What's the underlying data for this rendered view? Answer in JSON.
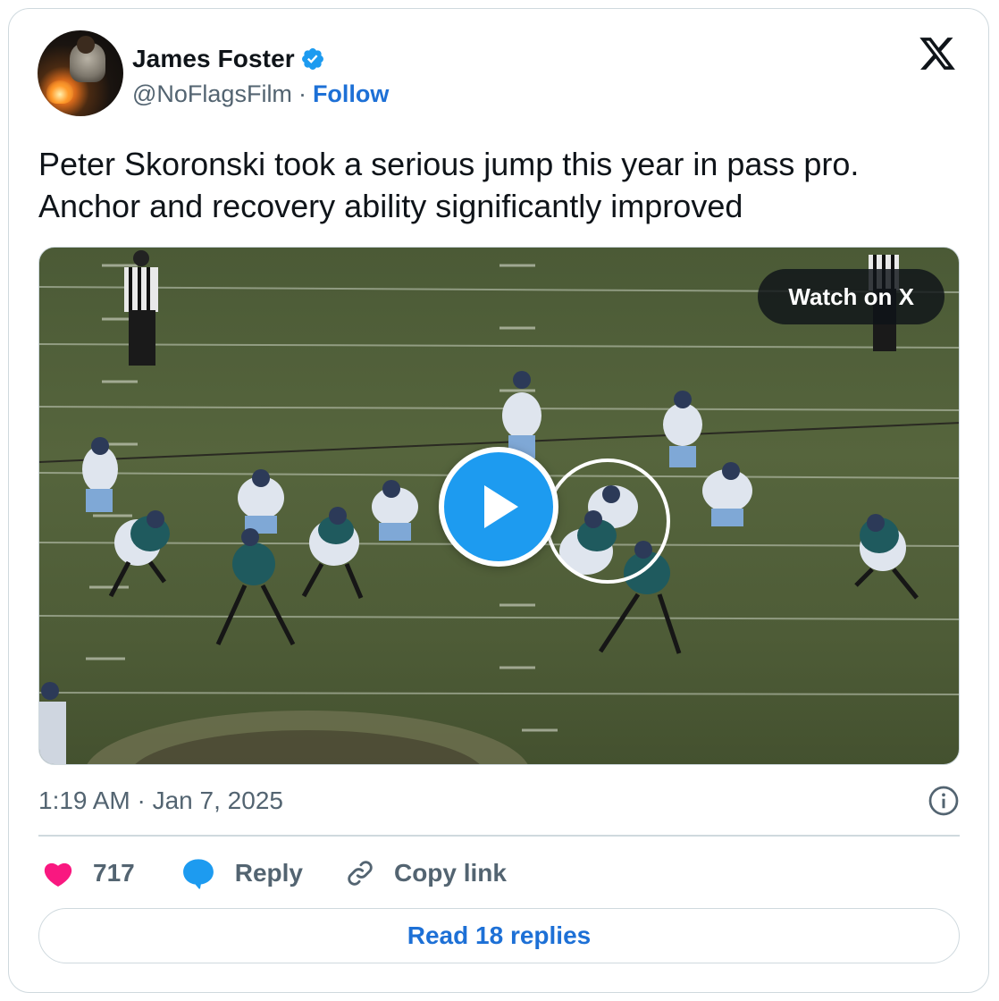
{
  "author": {
    "name": "James Foster",
    "handle": "@NoFlagsFilm",
    "separator": "·",
    "follow_label": "Follow"
  },
  "brand_icon": "x-logo-icon",
  "tweet": {
    "text": "Peter Skoronski took a serious jump this year in pass pro. Anchor and recovery ability significantly improved"
  },
  "media": {
    "watch_label": "Watch on X",
    "play_icon": "play-icon"
  },
  "meta": {
    "timestamp": "1:19 AM · Jan 7, 2025",
    "info_icon": "info-icon"
  },
  "actions": {
    "likes": "717",
    "reply_label": "Reply",
    "copy_label": "Copy link"
  },
  "footer": {
    "read_replies_label": "Read 18 replies"
  },
  "colors": {
    "link_blue": "#1d70d6",
    "verified_blue": "#1d9bf0",
    "heart_red": "#f91880",
    "muted_text": "#536471",
    "border": "#cfd9de"
  }
}
